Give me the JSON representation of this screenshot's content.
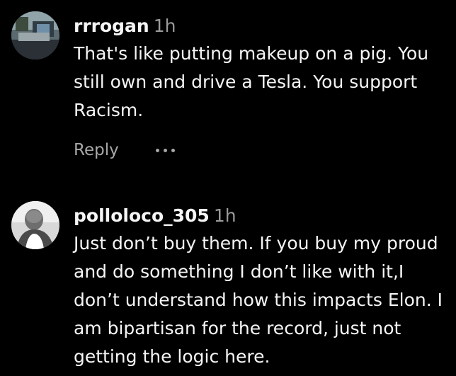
{
  "comments": [
    {
      "username": "rrrogan",
      "time": "1h",
      "text": "That's like putting makeup on a pig. You still own and drive a Tesla. You support Racism.",
      "reply_label": "Reply"
    },
    {
      "username": "polloloco_305",
      "time": "1h",
      "text": "Just don’t buy them. If you buy my proud and do something I don’t like with it,I don’t understand how this impacts Elon. I am bipartisan for the record, just not getting the logic here."
    }
  ],
  "colors": {
    "background": "#000000",
    "text": "#f5f5f5",
    "muted": "#9a9a9a"
  },
  "icons": {
    "more": "more-options-icon"
  }
}
